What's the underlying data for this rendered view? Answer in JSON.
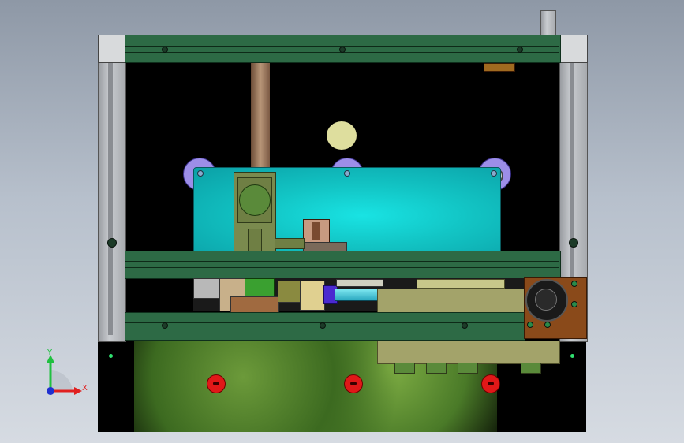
{
  "viewport": {
    "triad": {
      "y_label": "Y",
      "x_label": "X"
    }
  },
  "colors": {
    "frame_green": "#2d6a45",
    "plate_cyan": "#12c4c4",
    "roller_purple": "#9c8ee8",
    "motor_copper": "#8a4a1a",
    "background_top": "#8e98a6",
    "background_bottom": "#d6dbe2"
  },
  "icons": [
    "triad-icon",
    "roller-icon",
    "bolt-icon",
    "red-marker-icon",
    "motor-icon"
  ]
}
